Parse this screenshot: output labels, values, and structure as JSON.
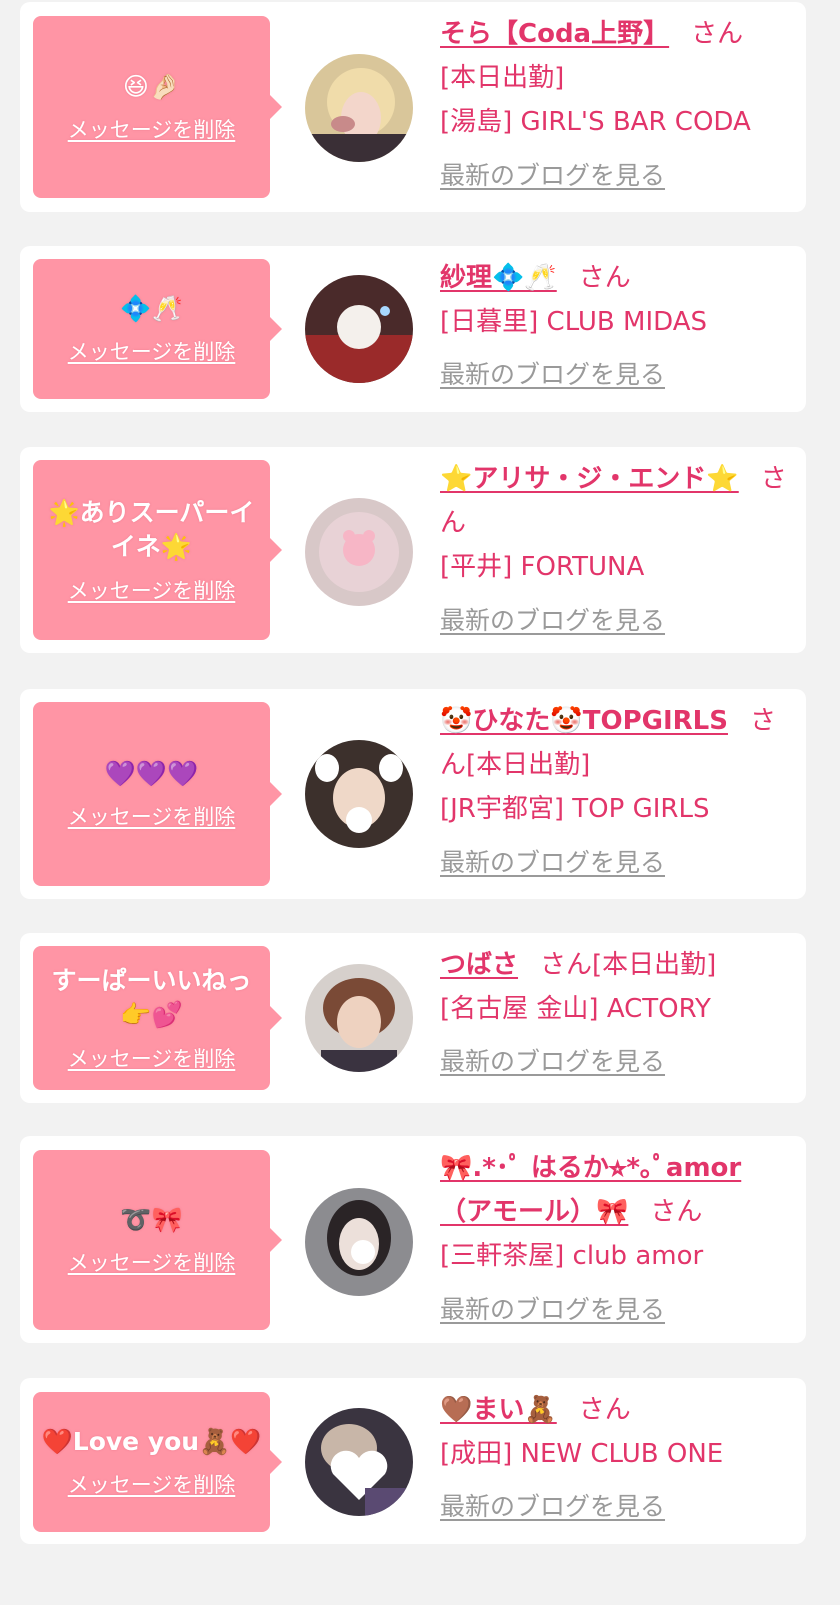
{
  "delete_label": "メッセージを削除",
  "honorific": "さん",
  "blog_label": "最新のブログを見る",
  "colors": {
    "background": "#f2f2f2",
    "card": "#ffffff",
    "bubble": "#ff95a5",
    "accent_text": "#e2356a",
    "blog_link": "#9a9a9a"
  },
  "items": [
    {
      "message": "😆🤌🏻",
      "name": "そら【Coda上野】",
      "status": "[本日出勤]",
      "shop": "[湯島] GIRL'S BAR CODA"
    },
    {
      "message": "💠🥂",
      "name": "紗理💠🥂",
      "status": "",
      "shop": "[日暮里] CLUB MIDAS"
    },
    {
      "message": "🌟ありスーパーイイネ🌟",
      "name": "⭐️アリサ・ジ・エンド⭐️",
      "status": "",
      "shop": "[平井] FORTUNA"
    },
    {
      "message": "💜💜💜",
      "name": "🤡ひなた🤡TOPGIRLS",
      "status": "[本日出勤]",
      "shop": "[JR宇都宮] TOP GIRLS"
    },
    {
      "message": "すーぱーいいねっ👉💕",
      "name": "つばさ",
      "status": "[本日出勤]",
      "shop": "[名古屋 金山] ACTORY"
    },
    {
      "message": "➰🎀",
      "name": "🎀.*･ﾟ はるか⭐︎*｡ﾟamor（アモール）🎀",
      "status": "",
      "shop": "[三軒茶屋] club amor"
    },
    {
      "message": "❤️Love you🧸❤️",
      "name": "🤎まい🧸",
      "status": "",
      "shop": "[成田] NEW CLUB ONE"
    }
  ]
}
